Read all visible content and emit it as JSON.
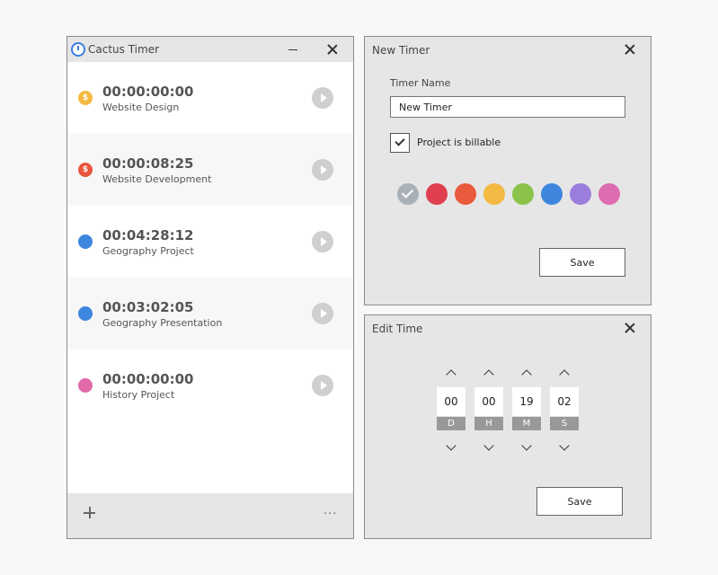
{
  "main_window": {
    "title": "Cactus Timer",
    "timers": [
      {
        "time": "00:00:00:00",
        "name": "Website Design",
        "color": "#f4b942",
        "billable": true,
        "icon": "$"
      },
      {
        "time": "00:00:08:25",
        "name": "Website Development",
        "color": "#e8553f",
        "billable": true,
        "icon": "$"
      },
      {
        "time": "00:04:28:12",
        "name": "Geography Project",
        "color": "#3e86de",
        "billable": false,
        "icon": ""
      },
      {
        "time": "00:03:02:05",
        "name": "Geography Presentation",
        "color": "#3e86de",
        "billable": false,
        "icon": ""
      },
      {
        "time": "00:00:00:00",
        "name": "History Project",
        "color": "#e06aa9",
        "billable": false,
        "icon": ""
      }
    ],
    "more_label": "..."
  },
  "new_timer": {
    "title": "New Timer",
    "name_label": "Timer Name",
    "name_value": "New Timer",
    "billable_label": "Project is billable",
    "billable_checked": true,
    "colors": [
      "#a9b0b8",
      "#df3f4f",
      "#ea5a3c",
      "#f4b942",
      "#8bc34a",
      "#3e86de",
      "#9b7ddd",
      "#dd6db0"
    ],
    "selected_color_index": 0,
    "save_label": "Save"
  },
  "edit_time": {
    "title": "Edit Time",
    "fields": [
      {
        "value": "00",
        "unit": "D"
      },
      {
        "value": "00",
        "unit": "H"
      },
      {
        "value": "19",
        "unit": "M"
      },
      {
        "value": "02",
        "unit": "S"
      }
    ],
    "save_label": "Save"
  }
}
